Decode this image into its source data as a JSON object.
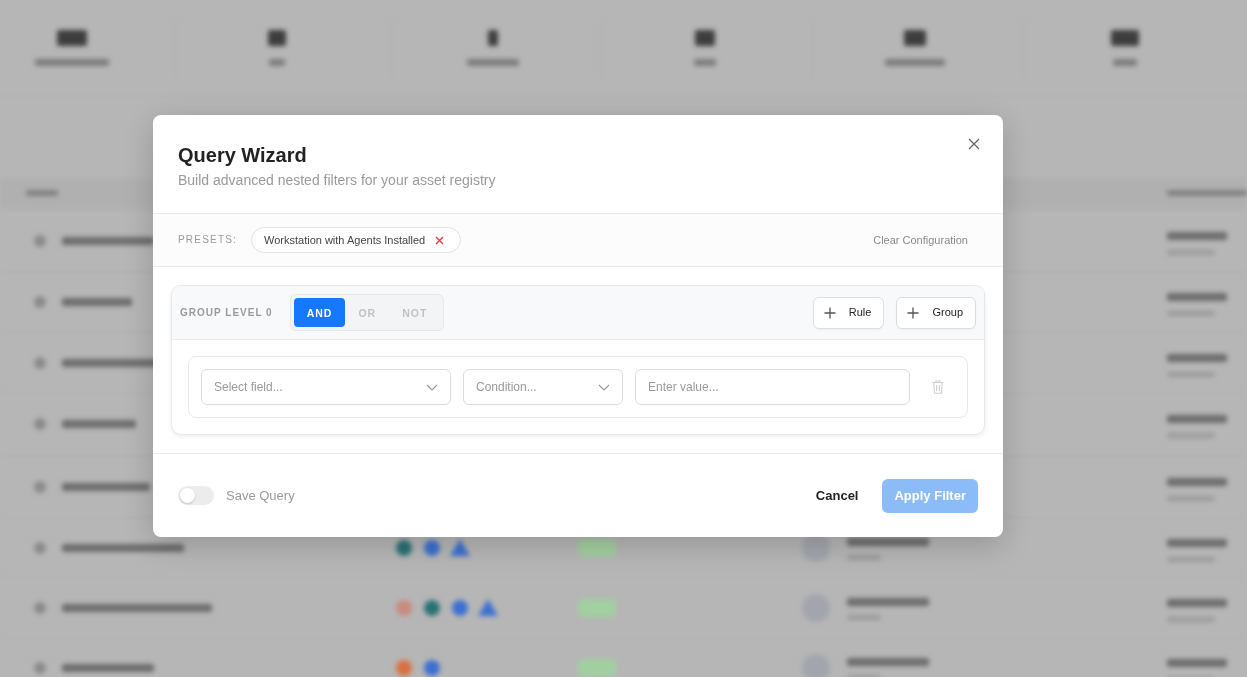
{
  "dialog": {
    "title": "Query Wizard",
    "subtitle": "Build advanced nested filters for your asset registry"
  },
  "presets": {
    "label": "PRESETS:",
    "chips": [
      {
        "label": "Workstation with Agents Installed"
      }
    ],
    "clear_action": "Clear Configuration"
  },
  "group": {
    "level_label": "GROUP LEVEL 0",
    "operators": [
      {
        "label": "AND",
        "selected": true
      },
      {
        "label": "OR",
        "selected": false
      },
      {
        "label": "NOT",
        "selected": false
      }
    ],
    "actions": [
      {
        "label": "Rule"
      },
      {
        "label": "Group"
      }
    ],
    "rules": [
      {
        "field": {
          "placeholder": "Select field..."
        },
        "condition": {
          "placeholder": "Condition..."
        },
        "value": {
          "placeholder": "Enter value..."
        }
      }
    ]
  },
  "footer": {
    "save_query": {
      "label": "Save Query",
      "on": false
    },
    "buttons": [
      {
        "label": "Cancel",
        "kind": "text",
        "disabled": false
      },
      {
        "label": "Apply Filter",
        "kind": "primary",
        "disabled": true
      }
    ]
  }
}
